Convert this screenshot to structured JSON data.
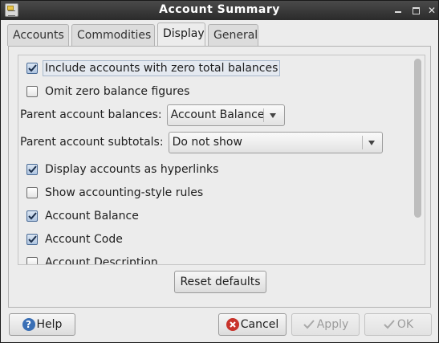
{
  "window": {
    "title": "Account Summary"
  },
  "tabs": [
    {
      "label": "Accounts",
      "active": false
    },
    {
      "label": "Commodities",
      "active": false
    },
    {
      "label": "Display",
      "active": true
    },
    {
      "label": "General",
      "active": false
    }
  ],
  "options": {
    "include_zero": {
      "label": "Include accounts with zero total balances",
      "checked": true
    },
    "omit_zero": {
      "label": "Omit zero balance figures",
      "checked": false
    },
    "display_hyperlinks": {
      "label": "Display accounts as hyperlinks",
      "checked": true
    },
    "accounting_rules": {
      "label": "Show accounting-style rules",
      "checked": false
    },
    "account_balance": {
      "label": "Account Balance",
      "checked": true
    },
    "account_code": {
      "label": "Account Code",
      "checked": true
    },
    "account_description": {
      "label": "Account Description",
      "checked": false
    }
  },
  "parent_balances": {
    "label": "Parent account balances:",
    "value": "Account Balance"
  },
  "parent_subtotals": {
    "label": "Parent account subtotals:",
    "value": "Do not show"
  },
  "buttons": {
    "reset": "Reset defaults",
    "help": "Help",
    "cancel": "Cancel",
    "apply": "Apply",
    "ok": "OK"
  },
  "scroll": {
    "visible_fraction": 0.76
  },
  "icons": {
    "help": "help-icon",
    "cancel": "cancel-icon",
    "apply": "checkmark-icon",
    "ok": "checkmark-icon"
  }
}
